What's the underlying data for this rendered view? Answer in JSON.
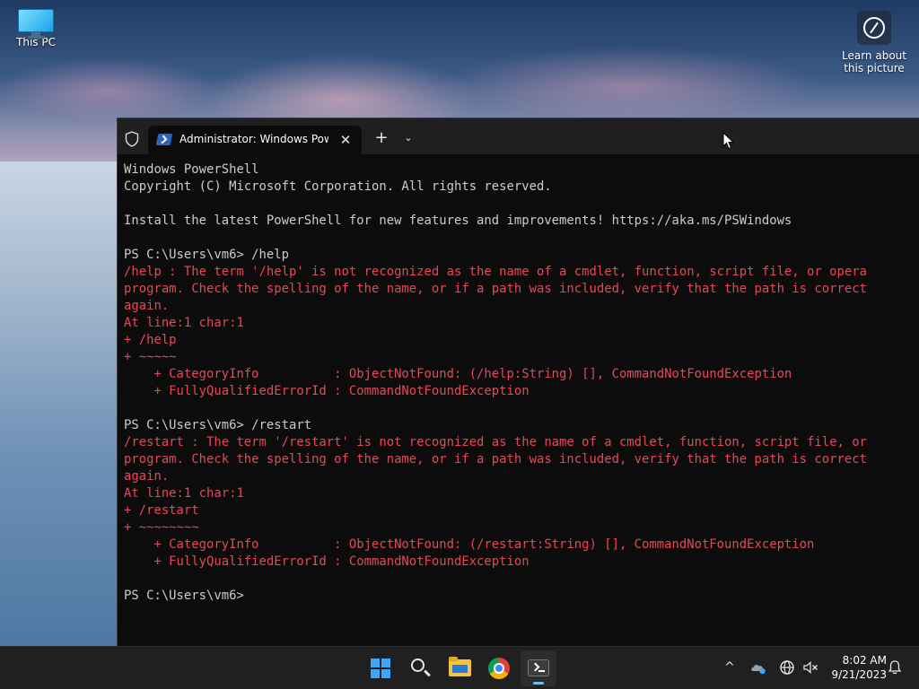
{
  "desktop": {
    "icons": [
      {
        "label": "This PC",
        "icon": "computer-icon"
      },
      {
        "label": "Learn about this picture",
        "icon": "camera-info-icon"
      }
    ]
  },
  "terminal": {
    "tab": {
      "title": "Administrator: Windows PowerShell",
      "icon": "powershell-icon",
      "close_glyph": "✕"
    },
    "new_tab_glyph": "+",
    "dropdown_glyph": "⌄",
    "lines": [
      {
        "text": "Windows PowerShell",
        "style": "normal"
      },
      {
        "text": "Copyright (C) Microsoft Corporation. All rights reserved.",
        "style": "normal"
      },
      {
        "text": "",
        "style": "normal"
      },
      {
        "text": "Install the latest PowerShell for new features and improvements! https://aka.ms/PSWindows",
        "style": "normal"
      },
      {
        "text": "",
        "style": "normal"
      },
      {
        "text": "PS C:\\Users\\vm6> /help",
        "style": "normal"
      },
      {
        "text": "/help : The term '/help' is not recognized as the name of a cmdlet, function, script file, or opera",
        "style": "err"
      },
      {
        "text": "program. Check the spelling of the name, or if a path was included, verify that the path is correct",
        "style": "err"
      },
      {
        "text": "again.",
        "style": "err"
      },
      {
        "text": "At line:1 char:1",
        "style": "err"
      },
      {
        "text": "+ /help",
        "style": "err"
      },
      {
        "text": "+ ~~~~~",
        "style": "err"
      },
      {
        "text": "    + CategoryInfo          : ObjectNotFound: (/help:String) [], CommandNotFoundException",
        "style": "err"
      },
      {
        "text": "    + FullyQualifiedErrorId : CommandNotFoundException",
        "style": "err"
      },
      {
        "text": "",
        "style": "normal"
      },
      {
        "text": "PS C:\\Users\\vm6> /restart",
        "style": "normal"
      },
      {
        "text": "/restart : The term '/restart' is not recognized as the name of a cmdlet, function, script file, or",
        "style": "err"
      },
      {
        "text": "program. Check the spelling of the name, or if a path was included, verify that the path is correct",
        "style": "err"
      },
      {
        "text": "again.",
        "style": "err"
      },
      {
        "text": "At line:1 char:1",
        "style": "err"
      },
      {
        "text": "+ /restart",
        "style": "err"
      },
      {
        "text": "+ ~~~~~~~~",
        "style": "err"
      },
      {
        "text": "    + CategoryInfo          : ObjectNotFound: (/restart:String) [], CommandNotFoundException",
        "style": "err"
      },
      {
        "text": "    + FullyQualifiedErrorId : CommandNotFoundException",
        "style": "err"
      },
      {
        "text": "",
        "style": "normal"
      },
      {
        "text": "PS C:\\Users\\vm6> ",
        "style": "normal"
      }
    ]
  },
  "colors": {
    "console_text": "#cccccc",
    "console_error": "#e74856",
    "console_bg": "#0c0c0c",
    "taskbar_bg": "#202020",
    "accent": "#76b9ed"
  },
  "taskbar": {
    "apps": [
      {
        "name": "start",
        "icon": "windows-logo-icon"
      },
      {
        "name": "search",
        "icon": "search-icon"
      },
      {
        "name": "file-explorer",
        "icon": "folder-icon"
      },
      {
        "name": "chrome",
        "icon": "chrome-icon"
      },
      {
        "name": "terminal",
        "icon": "terminal-icon",
        "active": true
      }
    ],
    "tray": {
      "chevron_glyph": "^",
      "time": "8:02 AM",
      "date": "9/21/2023"
    }
  }
}
